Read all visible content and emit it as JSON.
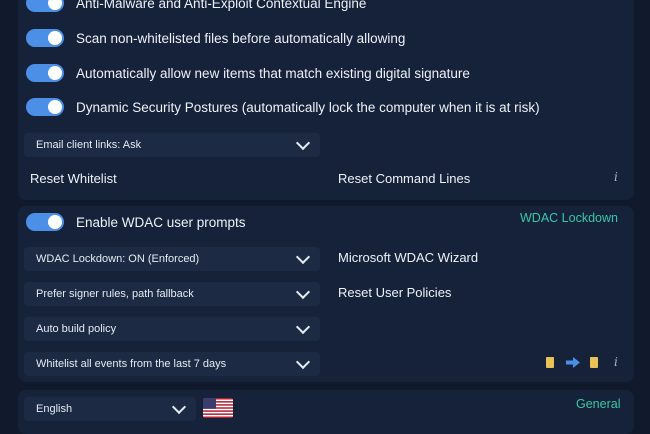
{
  "protection_panel": {
    "toggles": [
      {
        "label": "Anti-Malware and Anti-Exploit Contextual Engine",
        "on": true
      },
      {
        "label": "Scan non-whitelisted files before automatically allowing",
        "on": true
      },
      {
        "label": "Automatically allow new items that match existing digital signature",
        "on": true
      },
      {
        "label": "Dynamic Security Postures (automatically lock the computer when it is at risk)",
        "on": true
      }
    ],
    "email_select": {
      "value": "Email client links: Ask"
    },
    "reset_whitelist": "Reset Whitelist",
    "reset_command_lines": "Reset Command Lines",
    "info_glyph": "i"
  },
  "wdac_panel": {
    "title": "WDAC Lockdown",
    "toggle": {
      "label": "Enable WDAC user prompts",
      "on": true
    },
    "selects": [
      {
        "value": "WDAC Lockdown: ON (Enforced)"
      },
      {
        "value": "Prefer signer rules, path fallback"
      },
      {
        "value": "Auto build policy"
      },
      {
        "value": "Whitelist all events from the last 7 days"
      }
    ],
    "wizard": "Microsoft WDAC Wizard",
    "reset_policies": "Reset User Policies",
    "info_glyph": "i",
    "colors": {
      "accent": "#39c7a8",
      "toggle_on": "#4b8fe6"
    }
  },
  "general_panel": {
    "title": "General",
    "language_select": {
      "value": "English"
    },
    "flag_icon": "us-flag-icon"
  }
}
